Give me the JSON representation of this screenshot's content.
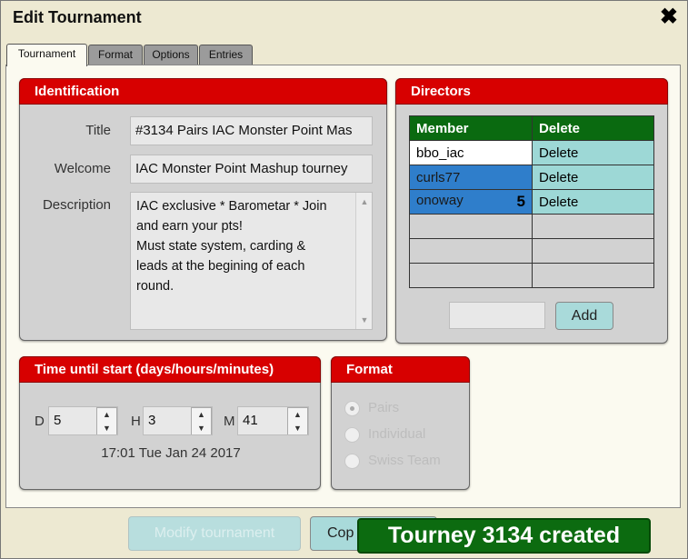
{
  "window": {
    "title": "Edit Tournament",
    "close_glyph": "✖"
  },
  "tabs": [
    {
      "label": "Tournament",
      "active": true
    },
    {
      "label": "Format"
    },
    {
      "label": "Options"
    },
    {
      "label": "Entries"
    }
  ],
  "identification": {
    "header": "Identification",
    "title_label": "Title",
    "title_value": "#3134 Pairs IAC Monster Point Mas",
    "welcome_label": "Welcome",
    "welcome_value": "IAC Monster Point Mashup tourney",
    "description_label": "Description",
    "description_lines": [
      "IAC exclusive * Barometar * Join",
      "and earn your pts!",
      "Must state system, carding &",
      "leads at the begining of each",
      "round."
    ]
  },
  "directors": {
    "header": "Directors",
    "col_member": "Member",
    "col_delete": "Delete",
    "rows": [
      {
        "member": "bbo_iac",
        "delete": "Delete",
        "selected": false,
        "badge": ""
      },
      {
        "member": "curls77",
        "delete": "Delete",
        "selected": true,
        "badge": ""
      },
      {
        "member": "onoway",
        "delete": "Delete",
        "selected": true,
        "badge": "5"
      }
    ],
    "add_label": "Add",
    "add_input_value": ""
  },
  "time_until_start": {
    "header": "Time until start (days/hours/minutes)",
    "d_label": "D",
    "d_value": "5",
    "h_label": "H",
    "h_value": "3",
    "m_label": "M",
    "m_value": "41",
    "start_datetime": "17:01 Tue Jan 24 2017"
  },
  "format": {
    "header": "Format",
    "options": [
      {
        "label": "Pairs",
        "selected": true
      },
      {
        "label": "Individual",
        "selected": false
      },
      {
        "label": "Swiss Team",
        "selected": false
      }
    ]
  },
  "buttons": {
    "modify_label": "Modify tournament",
    "copy_label_partial": "Cop"
  },
  "toast": {
    "message": "Tourney 3134 created"
  },
  "colors": {
    "header_red": "#d70000",
    "table_header_green": "#0a6a10",
    "selected_blue": "#2f7ecb",
    "delete_cyan": "#9dd8d6",
    "toast_green": "#0c6b10"
  }
}
